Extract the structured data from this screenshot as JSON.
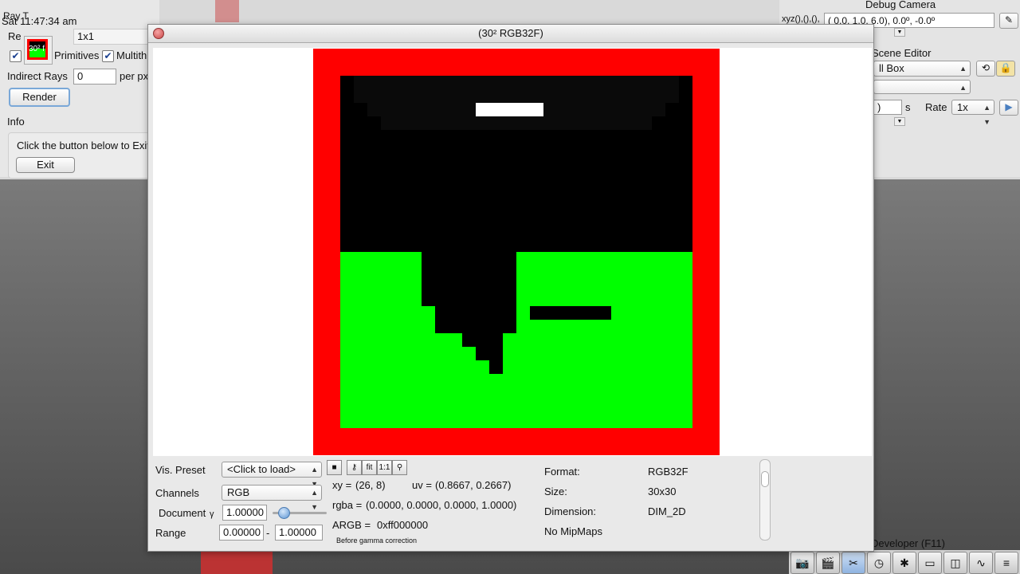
{
  "background": {
    "clock": "Sat 11:47:34 am",
    "ray_title": "Ray T",
    "thumbnail_label": "30² f"
  },
  "left_panel": {
    "resolution_label": "Re",
    "resolution_value": "1x1",
    "primitives_label": "Primitives",
    "multithread_label": "Multith",
    "indirect_rays_label": "Indirect Rays",
    "indirect_rays_value": "0",
    "per_px_label": "per px",
    "render_button": "Render",
    "info_label": "Info",
    "info_text": "Click the button below to Exit",
    "exit_button": "Exit"
  },
  "debug_camera": {
    "title": "Debug Camera",
    "xyz_label": "xyz(),(),(),",
    "xyz_value": "(  0.0,   1.0,   6.0),   0.0º,  -0.0º"
  },
  "scene_editor": {
    "title": "Scene Editor",
    "scene_select": "ll Box",
    "second_select": "",
    "time_value": ")",
    "time_unit": "s",
    "rate_label": "Rate",
    "rate_value": "1x"
  },
  "dock": {
    "developer_label": "Developer (F11)",
    "icons": [
      "camera-icon",
      "film-icon",
      "tools-icon",
      "clock-icon",
      "note-icon",
      "terminal-icon",
      "windows-icon",
      "graph-icon",
      "document-icon"
    ]
  },
  "window": {
    "title": "(30² RGB32F)",
    "vis_preset_label": "Vis. Preset",
    "vis_preset_value": "<Click to load>",
    "channels_label": "Channels",
    "channels_value": "RGB",
    "document_label": "Document",
    "gamma_symbol": "γ",
    "gamma_value": "1.00000",
    "range_label": "Range",
    "range_min": "0.00000",
    "range_sep": "-",
    "range_max": "1.00000",
    "tools": [
      "save-icon",
      "key-icon",
      "fit",
      "1:1",
      "pin-icon"
    ],
    "fit_label": "fit",
    "one_to_one_label": "1:1",
    "xy_label": "xy =",
    "xy_value": "(26, 8)",
    "uv_label": "uv =",
    "uv_value": "(0.8667, 0.2667)",
    "rgba_label": "rgba =",
    "rgba_value": "(0.0000, 0.0000, 0.0000, 1.0000)",
    "argb_label": "ARGB =",
    "argb_value": "0xff000000",
    "gamma_note": "Before gamma correction",
    "format_label": "Format:",
    "format_value": "RGB32F",
    "size_label": "Size:",
    "size_value": "30x30",
    "dimension_label": "Dimension:",
    "dimension_value": "DIM_2D",
    "mipmaps_text": "No MipMaps"
  },
  "colors": {
    "red": "#ff0000",
    "green": "#00ff00",
    "black": "#000000",
    "ceiling": "#0a0a0a",
    "white": "#ffffff"
  }
}
